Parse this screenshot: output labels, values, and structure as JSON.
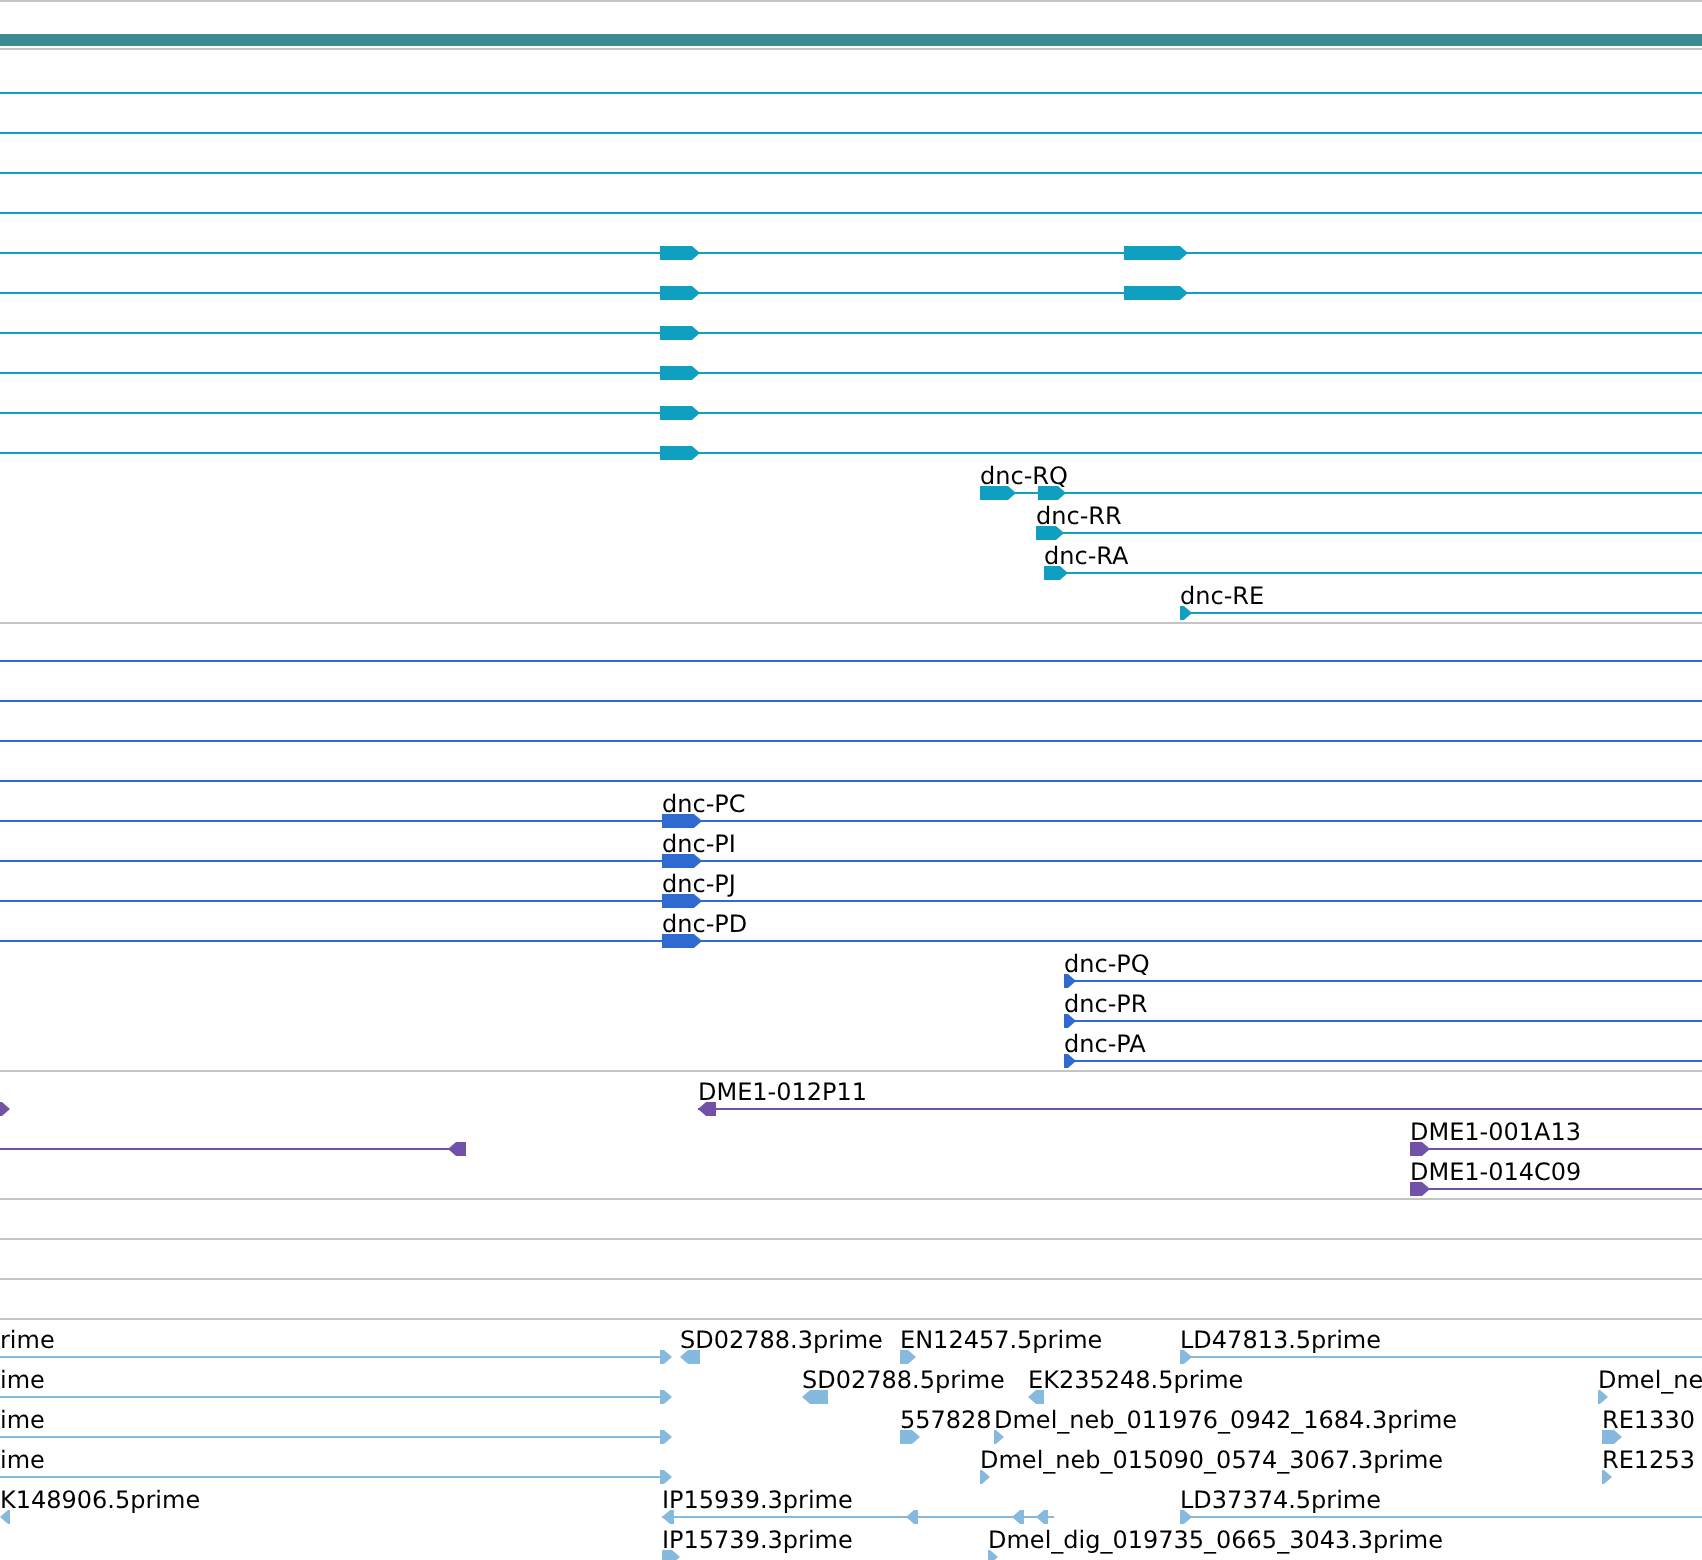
{
  "tracks": [
    {
      "kind": "gene",
      "color": "#0f9fc0",
      "rows": [
        {
          "labels": []
        },
        {
          "labels": []
        },
        {
          "labels": []
        },
        {
          "labels": []
        },
        {
          "labels": []
        },
        {
          "labels": []
        },
        {
          "labels": []
        },
        {
          "labels": []
        },
        {
          "labels": []
        },
        {
          "labels": []
        },
        {
          "labels": [
            "dnc-RQ"
          ]
        },
        {
          "labels": [
            "dnc-RR"
          ]
        },
        {
          "labels": [
            "dnc-RA"
          ]
        },
        {
          "labels": [
            "dnc-RE"
          ]
        }
      ]
    },
    {
      "kind": "gene",
      "color": "#2f6ad0",
      "rows": [
        {
          "labels": []
        },
        {
          "labels": []
        },
        {
          "labels": []
        },
        {
          "labels": []
        },
        {
          "labels": [
            "dnc-PC"
          ]
        },
        {
          "labels": [
            "dnc-PI"
          ]
        },
        {
          "labels": [
            "dnc-PJ"
          ]
        },
        {
          "labels": [
            "dnc-PD"
          ]
        },
        {
          "labels": [
            "dnc-PQ"
          ]
        },
        {
          "labels": [
            "dnc-PR"
          ]
        },
        {
          "labels": [
            "dnc-PA"
          ]
        }
      ]
    },
    {
      "kind": "clone",
      "color": "#7252a8",
      "rows": [
        {
          "labels": [
            "DME1-012P11"
          ]
        },
        {
          "labels": [
            "DME1-001A13"
          ]
        },
        {
          "labels": [
            "DME1-014C09"
          ]
        }
      ]
    },
    {
      "kind": "empty"
    },
    {
      "kind": "empty"
    },
    {
      "kind": "empty"
    },
    {
      "kind": "est",
      "color": "#86b9de",
      "rows": [
        {
          "labels": [
            "rime",
            "SD02788.3prime",
            "EN12457.5prime",
            "LD47813.5prime"
          ]
        },
        {
          "labels": [
            "ime",
            "SD02788.5prime",
            "EK235248.5prime",
            "Dmel_ne"
          ]
        },
        {
          "labels": [
            "ime",
            "557828",
            "Dmel_neb_011976_0942_1684.3prime",
            "RE1330"
          ]
        },
        {
          "labels": [
            "ime",
            "Dmel_neb_015090_0574_3067.3prime",
            "RE1253"
          ]
        },
        {
          "labels": [
            "K148906.5prime",
            "IP15939.3prime",
            "LD37374.5prime"
          ]
        },
        {
          "labels": [
            "IP15739.3prime",
            "Dmel_dig_019735_0665_3043.3prime"
          ]
        }
      ]
    }
  ]
}
